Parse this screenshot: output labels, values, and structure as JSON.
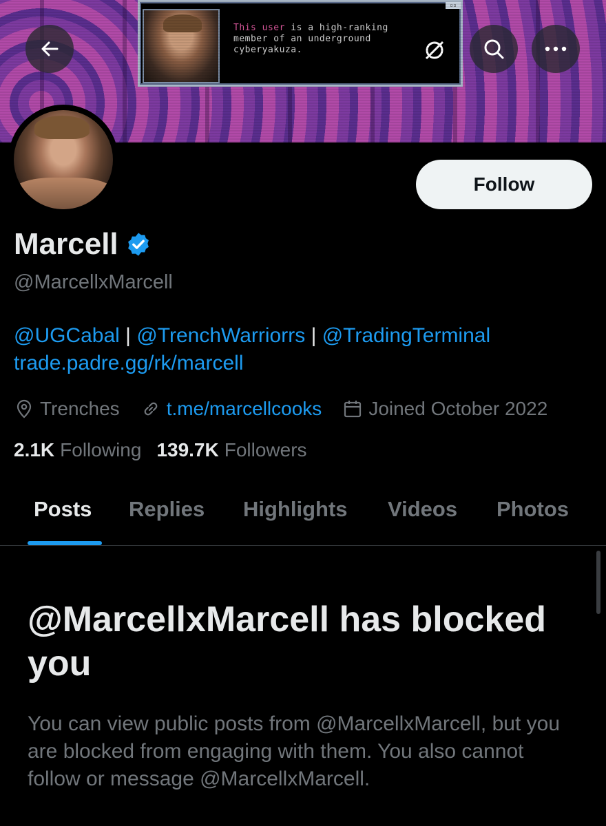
{
  "banner": {
    "text_highlight": "This user",
    "text_line1_rest": " is a high-ranking",
    "text_line2": "member of an underground",
    "text_line3": "cyberyakuza."
  },
  "nav": {
    "back_icon": "arrow-left-icon",
    "search_icon": "search-icon",
    "more_icon": "more-icon"
  },
  "profile": {
    "name": "Marcell",
    "handle": "@MarcellxMarcell",
    "follow_label": "Follow",
    "bio": {
      "mention1": "@UGCabal",
      "sep1": " | ",
      "mention2": "@TrenchWarriorrs",
      "sep2": " | ",
      "mention3": "@TradingTerminal",
      "link": "trade.padre.gg/rk/marcell"
    },
    "location": "Trenches",
    "website": "t.me/marcellcooks",
    "joined": "Joined October 2022",
    "following_count": "2.1K",
    "following_label": "Following",
    "followers_count": "139.7K",
    "followers_label": "Followers"
  },
  "tabs": [
    "Posts",
    "Replies",
    "Highlights",
    "Videos",
    "Photos"
  ],
  "blocked": {
    "title": "@MarcellxMarcell has blocked you",
    "description": "You can view public posts from @MarcellxMarcell, but you are blocked from engaging with them. You also cannot follow or message @MarcellxMarcell."
  },
  "colors": {
    "accent": "#1d9bf0",
    "text": "#e7e9ea",
    "muted": "#71767b",
    "background": "#000000"
  }
}
